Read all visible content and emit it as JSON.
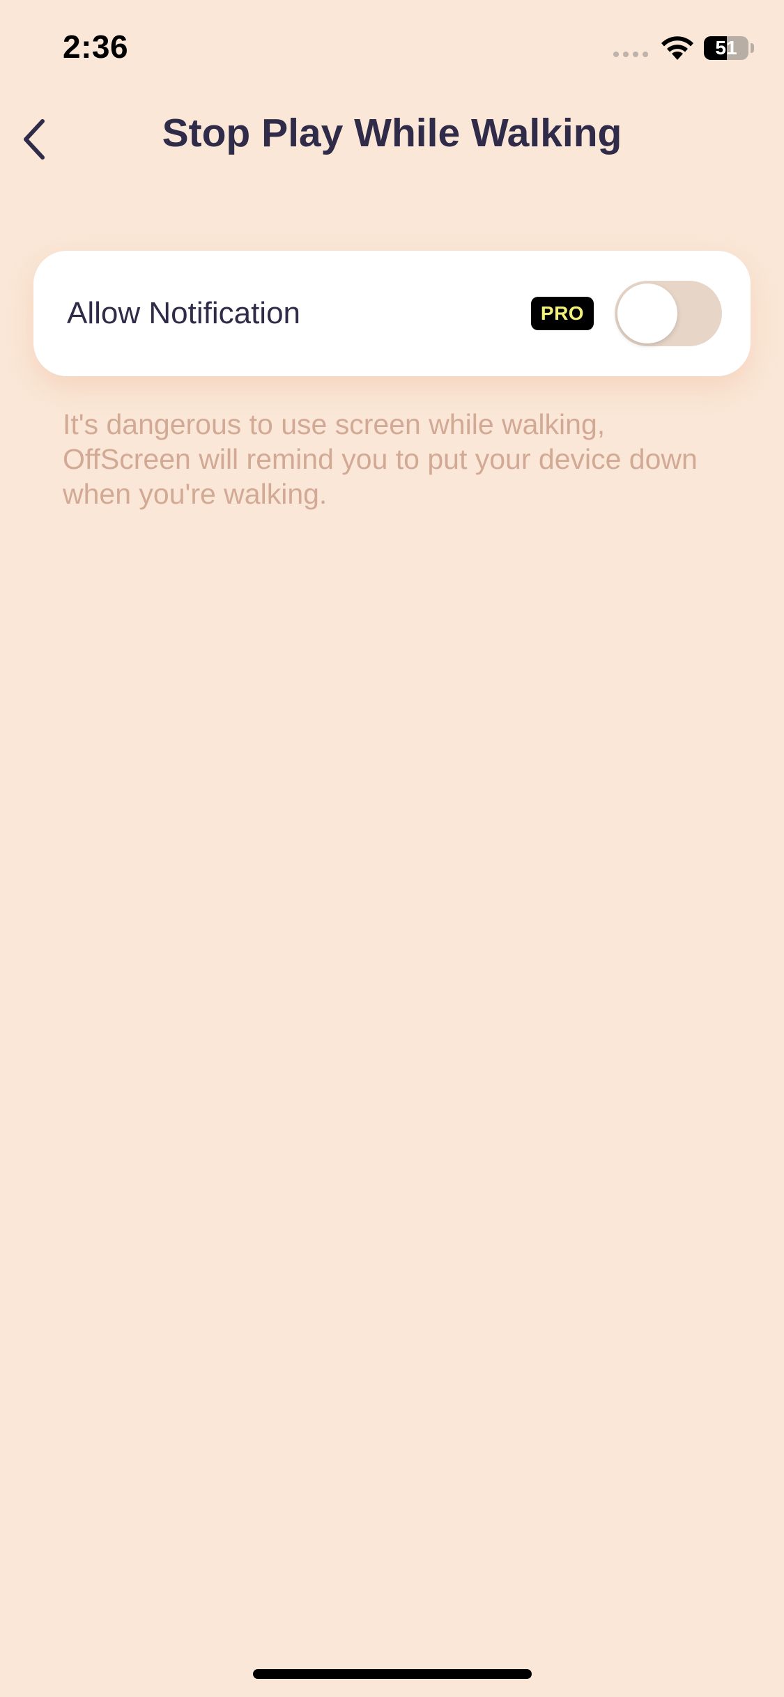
{
  "status_bar": {
    "time": "2:36",
    "battery_percent": "51",
    "battery_level": 0.51
  },
  "nav": {
    "title": "Stop Play While Walking",
    "back_icon": "chevron-left-icon"
  },
  "card": {
    "label": "Allow Notification",
    "badge": "PRO",
    "toggle_on": false
  },
  "description": "It's dangerous to use screen while walking, OffScreen will remind you to put your device down when you're walking.",
  "colors": {
    "background": "#FAE7D7",
    "title": "#2F2B48",
    "description": "#D2A995",
    "toggle_off_track": "#E7D6C8",
    "badge_bg": "#000000",
    "badge_text": "#F2F27A"
  }
}
